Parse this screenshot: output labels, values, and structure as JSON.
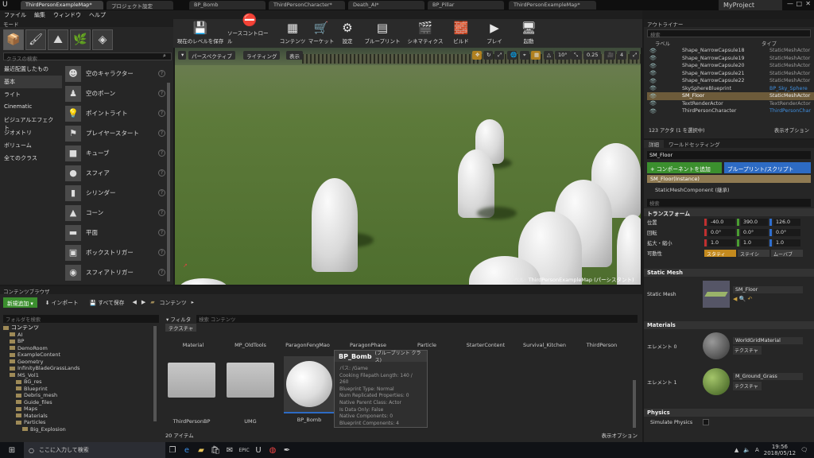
{
  "tabs": [
    "ThirdPersonExampleMap*",
    "プロジェクト設定",
    "BP_Bomb",
    "ThirdPersonCharacter*",
    "Death_AI*",
    "BP_Pillar",
    "ThirdPersonExampleMap*"
  ],
  "project_name": "MyProject",
  "menu": [
    "ファイル",
    "編集",
    "ウィンドウ",
    "ヘルプ"
  ],
  "modes": {
    "title": "モード",
    "search_placeholder": "クラスの検索",
    "categories": [
      "最近配置したもの",
      "基本",
      "ライト",
      "Cinematic",
      "ビジュアルエフェクト",
      "ジオメトリ",
      "ボリューム",
      "全てのクラス"
    ],
    "items": [
      "空のキャラクター",
      "空のポーン",
      "ポイントライト",
      "プレイヤースタート",
      "キューブ",
      "スフィア",
      "シリンダー",
      "コーン",
      "平面",
      "ボックストリガー",
      "スフィアトリガー"
    ]
  },
  "toolbar": [
    "現在のレベルを保存",
    "ソースコントロール",
    "コンテンツ",
    "マーケット",
    "設定",
    "ブループリント",
    "シネマティクス",
    "ビルド",
    "プレイ",
    "起動"
  ],
  "viewport": {
    "perspective": "パースペクティブ",
    "lighting": "ライティング",
    "show": "表示",
    "snap_angle": "10°",
    "scale": "0.25",
    "camera_speed": "4",
    "level_label": "レベル:",
    "level_name": "ThirdPersonExampleMap (パーシスタント)"
  },
  "outliner": {
    "title": "アウトライナー",
    "search_placeholder": "検索",
    "col_label": "ラベル",
    "col_type": "タイプ",
    "rows": [
      {
        "name": "Shape_NarrowCapsule18",
        "type": "StaticMeshActor"
      },
      {
        "name": "Shape_NarrowCapsule19",
        "type": "StaticMeshActor"
      },
      {
        "name": "Shape_NarrowCapsule20",
        "type": "StaticMeshActor"
      },
      {
        "name": "Shape_NarrowCapsule21",
        "type": "StaticMeshActor"
      },
      {
        "name": "Shape_NarrowCapsule22",
        "type": "StaticMeshActor"
      },
      {
        "name": "SkySphereBlueprint",
        "type": "BP_Sky_Sphere"
      },
      {
        "name": "SM_Floor",
        "type": "StaticMeshActor"
      },
      {
        "name": "TextRenderActor",
        "type": "TextRenderActor"
      },
      {
        "name": "ThirdPersonCharacter",
        "type": "ThirdPersonChar"
      }
    ],
    "count": "123 アクタ (1 を選択中)",
    "view_options": "表示オプション"
  },
  "details": {
    "tab_details": "詳細",
    "tab_world": "ワールドセッティング",
    "actor_name": "SM_Floor",
    "add_component": "+ コンポーネントを追加",
    "blueprint": "ブループリント/スクリプト",
    "instance": "SM_Floor(Instance)",
    "component": "StaticMeshComponent (継承)",
    "search_placeholder": "検索",
    "transform": "トランスフォーム",
    "location_label": "位置",
    "rotation_label": "回転",
    "scale_label": "拡大・縮小",
    "mobility_label": "可動性",
    "location": [
      "-40.0",
      "390.0",
      "126.0"
    ],
    "rotation": [
      "0.0°",
      "0.0°",
      "0.0°"
    ],
    "scale": [
      "1.0",
      "1.0",
      "1.0"
    ],
    "mobility": [
      "スタティ",
      "ステイシ",
      "ムーバブ"
    ],
    "static_mesh_section": "Static Mesh",
    "static_mesh_label": "Static Mesh",
    "static_mesh_value": "SM_Floor",
    "materials_section": "Materials",
    "element0_label": "エレメント 0",
    "element0_value": "WorldGridMaterial",
    "element1_label": "エレメント 1",
    "element1_value": "M_Ground_Grass",
    "texture_btn": "テクスチャ",
    "physics_section": "Physics",
    "simulate_physics": "Simulate Physics"
  },
  "content_browser": {
    "title": "コンテンツブラウザ",
    "add_new": "新規追加",
    "import": "インポート",
    "save_all": "すべて保存",
    "path": "コンテンツ",
    "folder_search": "フォルダを検索",
    "filters": "フィルタ",
    "content_search": "検索 コンテンツ",
    "texture_chip": "テクスチャ",
    "tree": [
      "コンテンツ",
      "AI",
      "BP",
      "DemoRoom",
      "ExampleContent",
      "Geometry",
      "InfinityBladeGrassLands",
      "MS_Vol1",
      "BG_res",
      "Blueprint",
      "Debris_mesh",
      "Guide_files",
      "Maps",
      "Materials",
      "Particles",
      "Big_Explosion"
    ],
    "folder_row": [
      "Material",
      "MP_OldTools",
      "ParagonFengMao",
      "ParagonPhase",
      "Particle",
      "StarterContent",
      "Survival_Kitchen",
      "ThirdPerson"
    ],
    "assets": [
      "ThirdPersonBP",
      "UMG",
      "BP_Bomb"
    ],
    "item_count": "20 アイテム",
    "view_options": "表示オプション"
  },
  "tooltip": {
    "title": "BP_Bomb",
    "subtitle": "(ブループリント クラス)",
    "lines": [
      "パス: /Game",
      "Cooking Filepath Length: 140 / 260",
      "Blueprint Type: Normal",
      "Num Replicated Properties: 0",
      "Native Parent Class: Actor",
      "Is Data Only: False",
      "Native Components: 0",
      "Blueprint Components: 4"
    ]
  },
  "taskbar": {
    "search_placeholder": "ここに入力して検索",
    "time": "19:56",
    "date": "2018/05/12"
  }
}
